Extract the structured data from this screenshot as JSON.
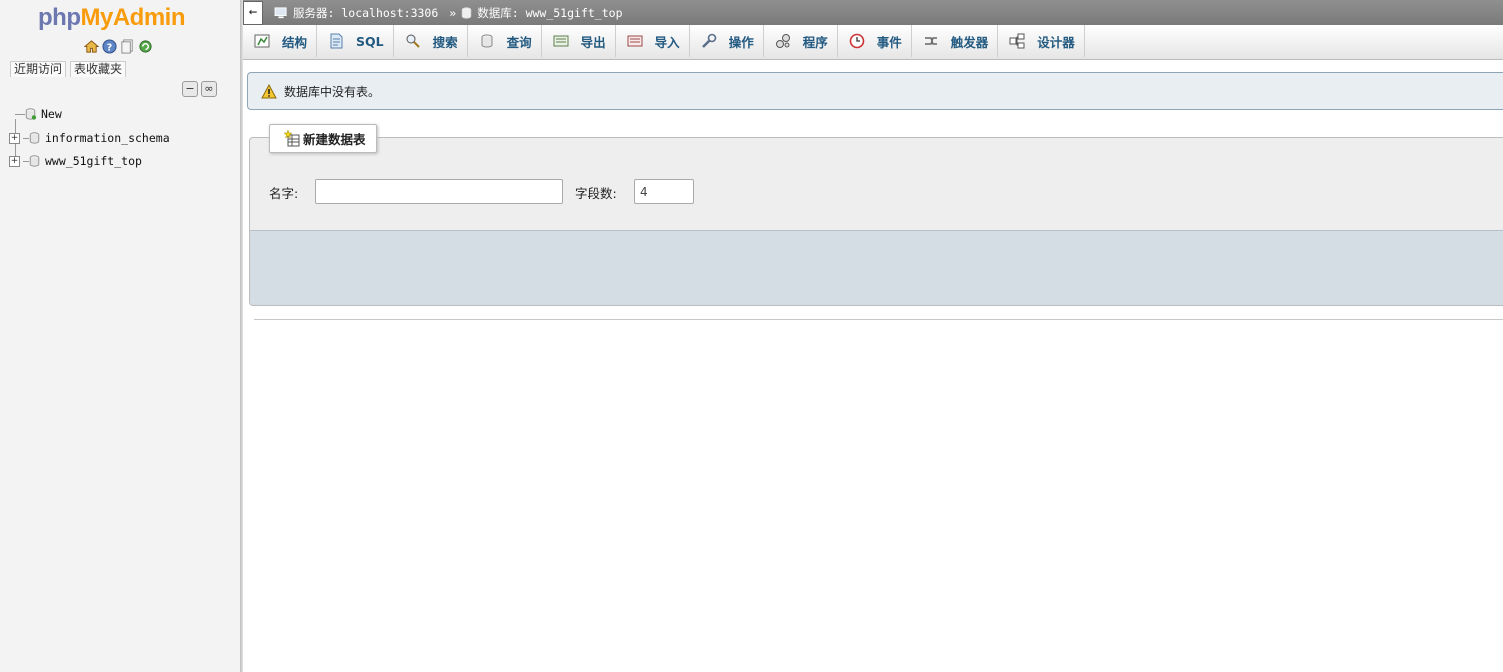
{
  "nav": {
    "logo_php": "php",
    "logo_myadmin": "MyAdmin",
    "icons": [
      "home-icon",
      "help-icon",
      "docs-icon",
      "reload-icon"
    ],
    "tabs": [
      "近期访问",
      "表收藏夹"
    ],
    "collapse_all": "−",
    "link_toggle": "∞",
    "tree": [
      {
        "label": "New",
        "type": "new"
      },
      {
        "label": "information_schema",
        "type": "db"
      },
      {
        "label": "www_51gift_top",
        "type": "db"
      }
    ]
  },
  "topbar": {
    "collapse_arrow": "←",
    "server_crumb": "服务器: localhost:3306",
    "separator": "»",
    "db_crumb": "数据库: www_51gift_top"
  },
  "menu": [
    {
      "label": "结构",
      "icon": "structure-icon"
    },
    {
      "label": "SQL",
      "icon": "sql-icon"
    },
    {
      "label": "搜索",
      "icon": "search-icon"
    },
    {
      "label": "查询",
      "icon": "query-icon"
    },
    {
      "label": "导出",
      "icon": "export-icon"
    },
    {
      "label": "导入",
      "icon": "import-icon"
    },
    {
      "label": "操作",
      "icon": "wrench-icon"
    },
    {
      "label": "程序",
      "icon": "routines-icon"
    },
    {
      "label": "事件",
      "icon": "events-icon"
    },
    {
      "label": "触发器",
      "icon": "triggers-icon"
    },
    {
      "label": "设计器",
      "icon": "designer-icon"
    }
  ],
  "notice": {
    "text": "数据库中没有表。",
    "icon": "warning-icon"
  },
  "create_table": {
    "legend": "新建数据表",
    "name_label": "名字:",
    "name_value": "",
    "columns_label": "字段数:",
    "columns_value": "4"
  },
  "colors": {
    "menu_text": "#235a81",
    "logo_php": "#6c78af",
    "logo_myadmin": "#f89c0e",
    "notice_bg": "#e9eef3",
    "footer_bg": "#d4dce4"
  }
}
